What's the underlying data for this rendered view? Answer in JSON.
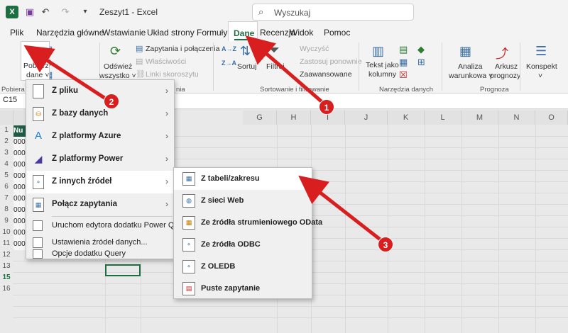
{
  "titlebar": {
    "app_icon": "X",
    "title": "Zeszyt1  -  Excel",
    "search_placeholder": "Wyszukaj",
    "icons": [
      "save-icon",
      "undo-icon",
      "redo-icon",
      "customize-icon"
    ]
  },
  "tabs": [
    {
      "label": "Plik"
    },
    {
      "label": "Narzędzia główne"
    },
    {
      "label": "Wstawianie"
    },
    {
      "label": "Układ strony"
    },
    {
      "label": "Formuły"
    },
    {
      "label": "Dane"
    },
    {
      "label": "Recenzja"
    },
    {
      "label": "Widok"
    },
    {
      "label": "Pomoc"
    }
  ],
  "ribbon": {
    "get_data": {
      "line1": "Pobierz",
      "line2": "dane ˅"
    },
    "refresh": {
      "line1": "Odśwież",
      "line2": "wszystko ˅"
    },
    "queries": "Zapytania i połączenia",
    "properties": "Właściwości",
    "links": "Linki skoroszytu",
    "sort_asc": "A→Z",
    "sort_desc": "Z→A",
    "sort": "Sortuj",
    "filter": "Filtruj",
    "clear": "Wyczyść",
    "reapply": "Zastosuj ponownie",
    "advanced": "Zaawansowane",
    "text_to_columns": {
      "line1": "Tekst jako",
      "line2": "kolumny"
    },
    "whatif": {
      "line1": "Analiza",
      "line2": "warunkowa ˅"
    },
    "forecast": {
      "line1": "Arkusz",
      "line2": "prognozy"
    },
    "outline": {
      "line1": "Konspekt",
      "line2": "˅"
    },
    "group_labels": {
      "pobieranie": "Pobiera",
      "queries_group": "nia",
      "sort_filter": "Sortowanie i filtrowanie",
      "data_tools": "Narzędzia danych",
      "forecast": "Prognoza"
    }
  },
  "formula_bar": {
    "name_box": "C15"
  },
  "grid": {
    "columns": [
      "G",
      "H",
      "I",
      "J",
      "K",
      "L",
      "M",
      "N",
      "O"
    ],
    "rows": [
      "1",
      "2",
      "3",
      "4",
      "5",
      "6",
      "7",
      "8",
      "9",
      "10",
      "11",
      "12",
      "13",
      "14",
      "15",
      "16"
    ],
    "cellA": [
      "Nu",
      "000",
      "000",
      "000",
      "000",
      "000",
      "000",
      "000",
      "000",
      "000",
      "000"
    ]
  },
  "menu_get_data": {
    "items": [
      {
        "label": "Z pliku"
      },
      {
        "label": "Z bazy danych"
      },
      {
        "label": "Z platformy Azure"
      },
      {
        "label": "Z platformy Power"
      },
      {
        "label": "Z innych źródeł"
      },
      {
        "label": "Połącz zapytania"
      }
    ],
    "small_items": [
      {
        "label": "Uruchom edytora dodatku Power Query..."
      },
      {
        "label": "Ustawienia źródeł danych..."
      },
      {
        "label": "Opcje dodatku Query"
      }
    ]
  },
  "menu_other_sources": {
    "items": [
      {
        "label": "Z tabeli/zakresu"
      },
      {
        "label": "Z sieci Web"
      },
      {
        "label": "Ze źródła strumieniowego OData"
      },
      {
        "label": "Ze źródła ODBC"
      },
      {
        "label": "Z OLEDB"
      },
      {
        "label": "Puste zapytanie"
      }
    ]
  },
  "annotations": {
    "one": "1",
    "two": "2",
    "three": "3",
    "color": "#d81e1e"
  }
}
